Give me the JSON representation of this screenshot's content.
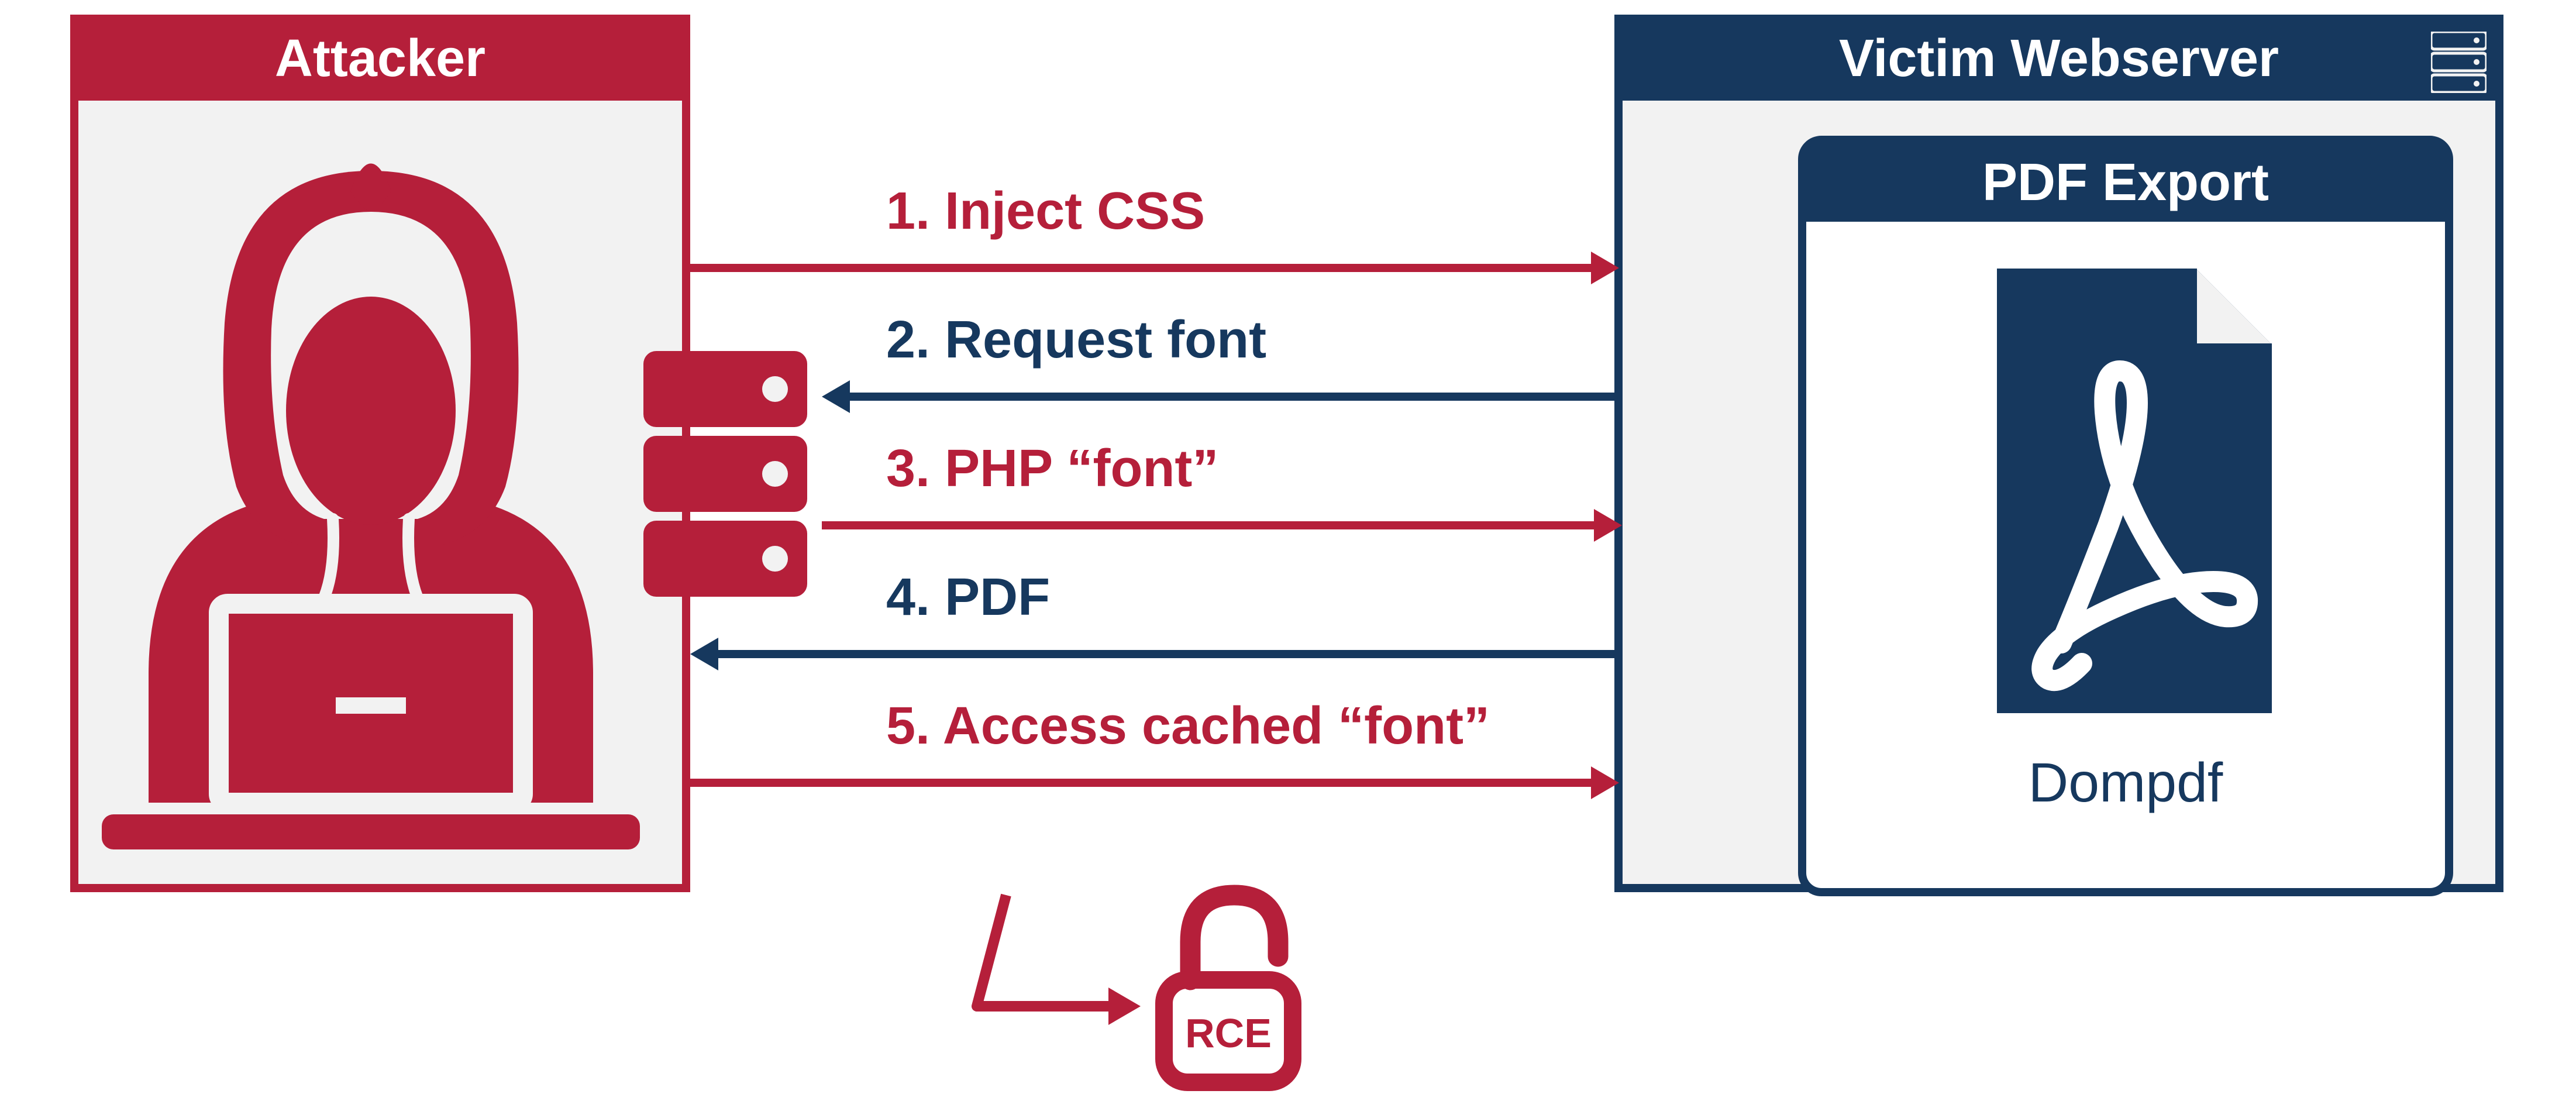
{
  "attacker": {
    "title": "Attacker"
  },
  "victim": {
    "title": "Victim Webserver",
    "pdf_export_title": "PDF Export",
    "dompdf_label": "Dompdf"
  },
  "steps": {
    "s1": "1. Inject CSS",
    "s2": "2. Request font",
    "s3": "3. PHP “font”",
    "s4": "4. PDF",
    "s5": "5. Access cached “font”"
  },
  "rce": {
    "label": "RCE"
  },
  "colors": {
    "red": "#b51f3a",
    "navy": "#16385e"
  }
}
